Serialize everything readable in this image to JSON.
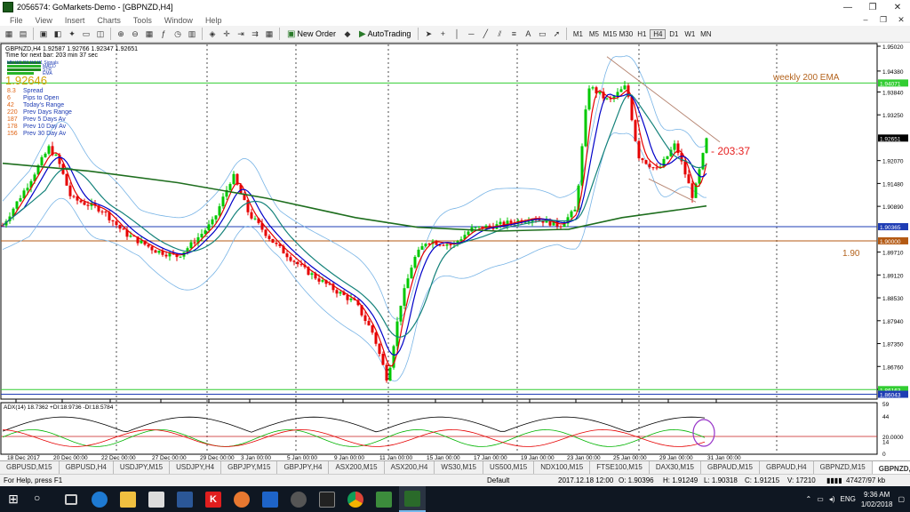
{
  "window": {
    "title": "2056574: GoMarkets-Demo - [GBPNZD,H4]",
    "controls": [
      "—",
      "❐",
      "✕"
    ]
  },
  "menu": {
    "items": [
      "File",
      "View",
      "Insert",
      "Charts",
      "Tools",
      "Window",
      "Help"
    ],
    "right_controls": [
      "–",
      "❐",
      "✕"
    ]
  },
  "toolbar": {
    "new_order_label": "New Order",
    "autotrading_label": "AutoTrading",
    "timeframes": [
      "M1",
      "M5",
      "M15",
      "M30",
      "H1",
      "H4",
      "D1",
      "W1",
      "MN"
    ],
    "active_timeframe": "H4"
  },
  "chart": {
    "header": "GBPNZD,H4  1.92587 1.92766 1.92347 1.92651",
    "timer_text": "Time for next bar: 203 min 37 sec",
    "current_price_big": "1.92646",
    "legend_rows": [
      "MN W1 D1 H4 H1 Signals",
      "MACD",
      "STR",
      "EMA"
    ],
    "info_rows": [
      {
        "value": "8.3",
        "label": "Spread"
      },
      {
        "value": "6",
        "label": "Pips to Open"
      },
      {
        "value": "42",
        "label": "Today's Range"
      },
      {
        "value": "220",
        "label": "Prev Days Range"
      },
      {
        "value": "187",
        "label": "Prev 5 Days Av"
      },
      {
        "value": "178",
        "label": "Prev 10 Day Av"
      },
      {
        "value": "156",
        "label": "Prev 30 Day Av"
      }
    ],
    "price_axis": [
      "1.95020",
      "1.94380",
      "1.93840",
      "1.93250",
      "1.92070",
      "1.91480",
      "1.90890",
      "1.89710",
      "1.89120",
      "1.88530",
      "1.87940",
      "1.87350",
      "1.86760",
      "1.86170"
    ],
    "price_tags": [
      {
        "label": "1.94071",
        "color": "#32cd32"
      },
      {
        "label": "1.92651",
        "color": "#000000"
      },
      {
        "label": "1.90365",
        "color": "#1e3cb4"
      },
      {
        "label": "1.90000",
        "color": "#b45a14"
      },
      {
        "label": "1.86163",
        "color": "#32cd32"
      },
      {
        "label": "1.86043",
        "color": "#1e3cb4"
      }
    ],
    "time_axis": [
      "18 Dec 2017",
      "20 Dec 00:00",
      "22 Dec 00:00",
      "27 Dec 00:00",
      "29 Dec 00:00",
      "3 Jan 00:00",
      "5 Jan 00:00",
      "9 Jan 00:00",
      "11 Jan 00:00",
      "15 Jan 00:00",
      "17 Jan 00:00",
      "19 Jan 00:00",
      "23 Jan 00:00",
      "25 Jan 00:00",
      "29 Jan 00:00",
      "31 Jan 00:00"
    ],
    "annotations": {
      "weekly_ema": "weekly 200 EMA",
      "level": "1.90",
      "countdown": "- 203:37"
    },
    "adx_header": "ADX(14) 18.7362 +DI:18.9736 -DI:18.5784",
    "adx_axis": [
      "59",
      "44",
      "20.0000",
      "14",
      "0"
    ]
  },
  "tabs": [
    "GBPUSD,M15",
    "GBPUSD,H4",
    "USDJPY,M15",
    "USDJPY,H4",
    "GBPJPY,M15",
    "GBPJPY,H4",
    "ASX200,M15",
    "ASX200,H4",
    "WS30,M15",
    "US500,M15",
    "NDX100,M15",
    "FTSE100,M15",
    "DAX30,M15",
    "GBPAUD,M15",
    "GBPAUD,H4",
    "GBPNZD,M15",
    "GBPNZD,H4",
    "EUR"
  ],
  "active_tab": "GBPNZD,H4",
  "status": {
    "help": "For Help, press F1",
    "profile": "Default",
    "datetime": "2017.12.18 12:00",
    "open": "O: 1.90396",
    "high": "H: 1.91249",
    "low": "L: 1.90318",
    "close": "C: 1.91215",
    "volume": "V: 17210",
    "traffic": "47427/97 kb"
  },
  "taskbar": {
    "lang": "ENG",
    "time": "9:36 AM",
    "date": "1/02/2018"
  }
}
